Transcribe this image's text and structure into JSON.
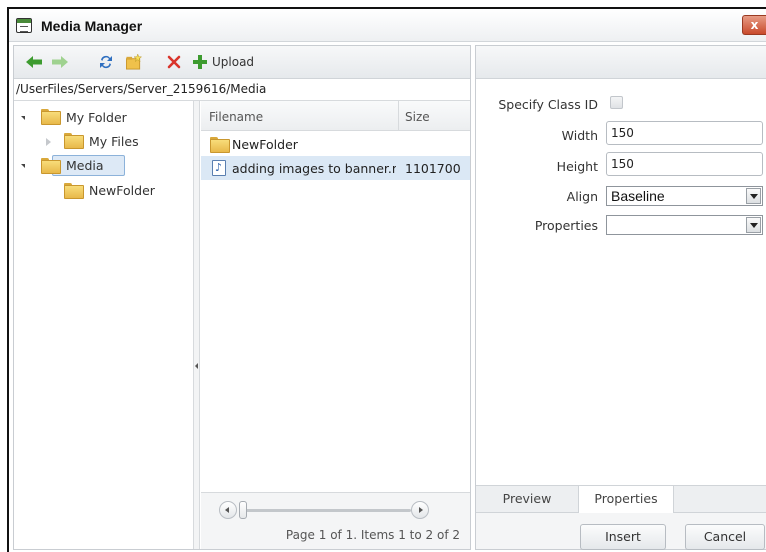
{
  "window": {
    "title": "Media Manager",
    "close_label": "x"
  },
  "toolbar": {
    "buttons": [
      {
        "icon": "back-arrow-icon"
      },
      {
        "icon": "forward-arrow-icon"
      },
      {
        "icon": "refresh-icon"
      },
      {
        "icon": "new-folder-icon"
      },
      {
        "icon": "delete-icon"
      },
      {
        "icon": "upload-icon",
        "label": "Upload"
      }
    ]
  },
  "path": "/UserFiles/Servers/Server_2159616/Media",
  "tree": [
    {
      "label": "My Folder",
      "expanded": true
    },
    {
      "label": "My Files",
      "expanded": false
    },
    {
      "label": "Media",
      "expanded": true,
      "selected": true
    },
    {
      "label": "NewFolder"
    }
  ],
  "grid": {
    "columns": [
      "Filename",
      "Size"
    ],
    "rows": [
      {
        "name": "NewFolder",
        "size": "",
        "type": "folder"
      },
      {
        "name": "adding images to banner.m",
        "size": "1101700",
        "type": "file",
        "selected": true
      }
    ]
  },
  "pager": {
    "text": "Page 1 of 1. Items 1 to 2 of 2"
  },
  "properties": {
    "class_id_label": "Specify Class ID",
    "width_label": "Width",
    "width_value": "150",
    "height_label": "Height",
    "height_value": "150",
    "align_label": "Align",
    "align_value": "Baseline",
    "props_label": "Properties",
    "props_value": ""
  },
  "tabs": [
    "Preview",
    "Properties"
  ],
  "active_tab": "Properties",
  "actions": {
    "insert": "Insert",
    "cancel": "Cancel"
  },
  "colors": {
    "selection": "#dbe8f5",
    "close_button": "#c94a2c",
    "folder": "#f2c85a"
  }
}
